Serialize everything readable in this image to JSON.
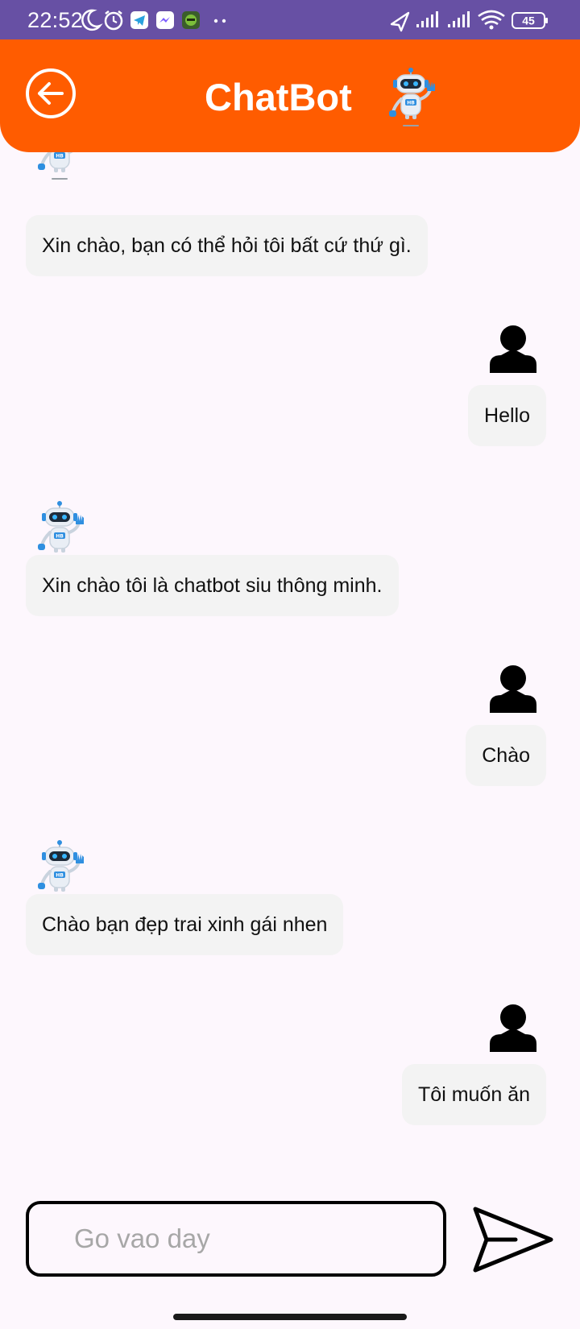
{
  "status_bar": {
    "time": "22:52",
    "battery": "45",
    "icons": [
      "moon-icon",
      "alarm-icon",
      "telegram-icon",
      "messenger-icon",
      "app-icon",
      "more-dots-icon",
      "location-icon",
      "signal-icon",
      "signal-icon",
      "wifi-icon",
      "battery-icon"
    ]
  },
  "header": {
    "title": "ChatBot",
    "back_icon": "back-arrow-icon",
    "robot_icon": "robot-icon"
  },
  "messages": [
    {
      "sender": "bot",
      "text": "Xin chào, bạn có thể hỏi tôi bất cứ thứ gì."
    },
    {
      "sender": "user",
      "text": "Hello"
    },
    {
      "sender": "bot",
      "text": "Xin chào tôi là chatbot siu thông minh."
    },
    {
      "sender": "user",
      "text": "Chào"
    },
    {
      "sender": "bot",
      "text": "Chào bạn đẹp trai xinh gái nhen"
    },
    {
      "sender": "user",
      "text": "Tôi muốn ăn"
    }
  ],
  "composer": {
    "placeholder": "Go vao day",
    "value": "",
    "send_icon": "send-icon"
  },
  "colors": {
    "status_bar": "#6750a4",
    "header": "#ff5c00",
    "background": "#fdf7fd",
    "bubble": "#f3f3f3",
    "robot_blue": "#2f8fe0"
  }
}
